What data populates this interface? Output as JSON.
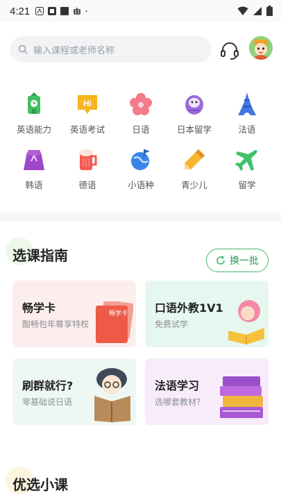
{
  "status": {
    "time": "4:21"
  },
  "search": {
    "placeholder": "输入课程或老师名称"
  },
  "categories": [
    {
      "label": "英语能力",
      "icon": "clock-tower-icon"
    },
    {
      "label": "英语考试",
      "icon": "hi-bubble-icon"
    },
    {
      "label": "日语",
      "icon": "sakura-icon"
    },
    {
      "label": "日本留学",
      "icon": "daruma-icon"
    },
    {
      "label": "法语",
      "icon": "eiffel-tower-icon"
    },
    {
      "label": "韩语",
      "icon": "hanbok-icon"
    },
    {
      "label": "德语",
      "icon": "beer-mug-icon"
    },
    {
      "label": "小语种",
      "icon": "globe-flag-icon"
    },
    {
      "label": "青少儿",
      "icon": "pencil-icon"
    },
    {
      "label": "留学",
      "icon": "airplane-icon"
    }
  ],
  "guide": {
    "title": "选课指南",
    "cards": [
      {
        "title": "畅学卡",
        "subtitle": "酣畅包年尊享特权",
        "badge": "畅学卡",
        "bg": "#fdeeee"
      },
      {
        "title": "口语外教1V1",
        "subtitle": "免费试学",
        "bg": "#e6f7ef"
      },
      {
        "title": "刷群就行?",
        "subtitle": "零基础说日语",
        "bg": "#eef8f3"
      },
      {
        "title": "法语学习",
        "subtitle": "选哪套教材?",
        "bg": "#f8ecfb"
      }
    ]
  },
  "picks": {
    "title": "优选小课",
    "refresh_label": "换一批"
  },
  "colors": {
    "accent": "#3cb56a"
  }
}
